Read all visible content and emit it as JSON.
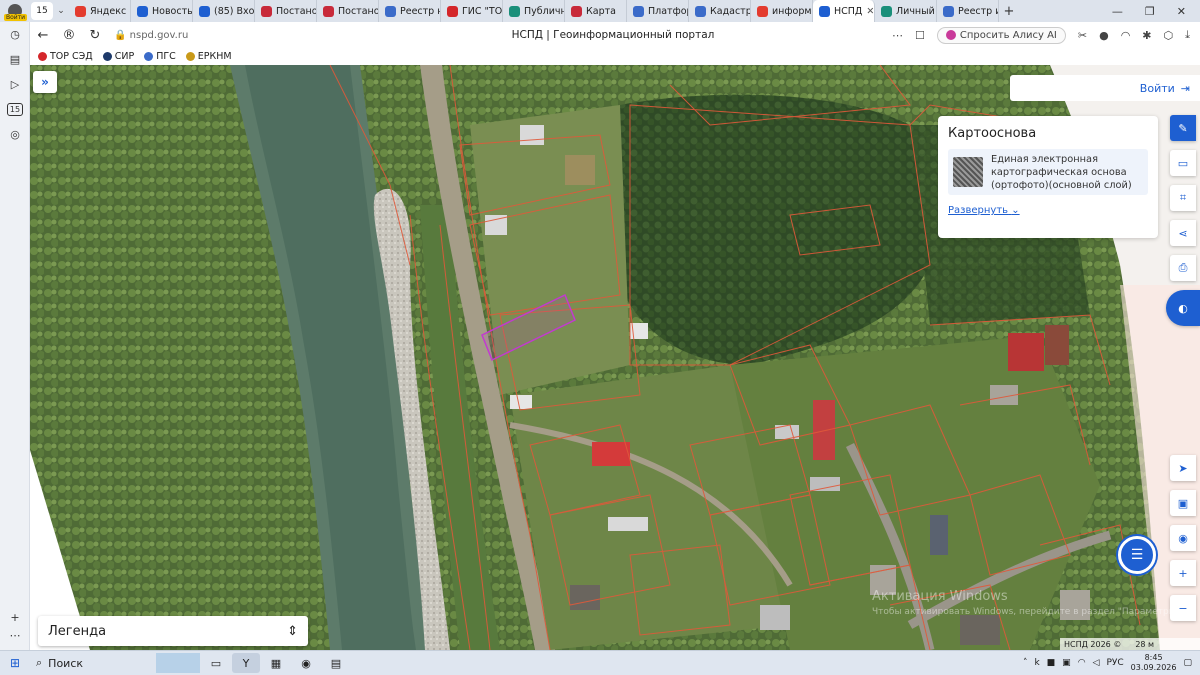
{
  "browser": {
    "profile_label": "Войти",
    "tab_count": "15",
    "tabs": [
      {
        "label": "Яндекс",
        "color": "#e33b2e",
        "active": false
      },
      {
        "label": "Новость",
        "color": "#1e5fd1",
        "active": false
      },
      {
        "label": "(85) Вход",
        "color": "#1e5fd1",
        "active": false
      },
      {
        "label": "Постано",
        "color": "#c82a3a",
        "active": false
      },
      {
        "label": "Постано",
        "color": "#c82a3a",
        "active": false
      },
      {
        "label": "Реестр н",
        "color": "#3b6bc9",
        "active": false
      },
      {
        "label": "ГИС \"ТО",
        "color": "#d4262a",
        "active": false
      },
      {
        "label": "Публичн",
        "color": "#1a8f7a",
        "active": false
      },
      {
        "label": "Карта",
        "color": "#c82a3a",
        "active": false
      },
      {
        "label": "Платфор",
        "color": "#3b6bc9",
        "active": false
      },
      {
        "label": "Кадастр",
        "color": "#3b6bc9",
        "active": false
      },
      {
        "label": "информ",
        "color": "#e33b2e",
        "active": false
      },
      {
        "label": "НСПД",
        "color": "#1e5fd1",
        "active": true
      },
      {
        "label": "Личный",
        "color": "#1a8f7a",
        "active": false
      },
      {
        "label": "Реестр и",
        "color": "#3b6bc9",
        "active": false
      }
    ],
    "url": "nspd.gov.ru",
    "page_title": "НСПД | Геоинформационный портал",
    "alice_button": "Спросить Алису AI",
    "bookmarks": [
      {
        "label": "ТОР СЭД",
        "color": "#d4262a"
      },
      {
        "label": "СИР",
        "color": "#1e3a6a"
      },
      {
        "label": "ПГС",
        "color": "#3b6bc9"
      },
      {
        "label": "ЕРКНМ",
        "color": "#c99a1a"
      }
    ]
  },
  "map": {
    "login_label": "Войти",
    "basemap_panel": {
      "title": "Картооснова",
      "layer_name": "Единая электронная картографическая основа (ортофото)(основной слой)",
      "expand_label": "Развернуть"
    },
    "legend_label": "Легенда",
    "watermark_line1": "Активация Windows",
    "watermark_line2": "Чтобы активировать Windows, перейдите в раздел \"Параметры\".",
    "copyright": "НСПД 2026 ©",
    "scale_label": "28 м"
  },
  "taskbar": {
    "search_label": "Поиск",
    "language": "РУС",
    "time": "8:45",
    "date": "03.09.2026"
  },
  "colors": {
    "accent": "#1e5fd1",
    "parcel_border": "#e0593a",
    "selected_parcel": "#c23ad0"
  }
}
